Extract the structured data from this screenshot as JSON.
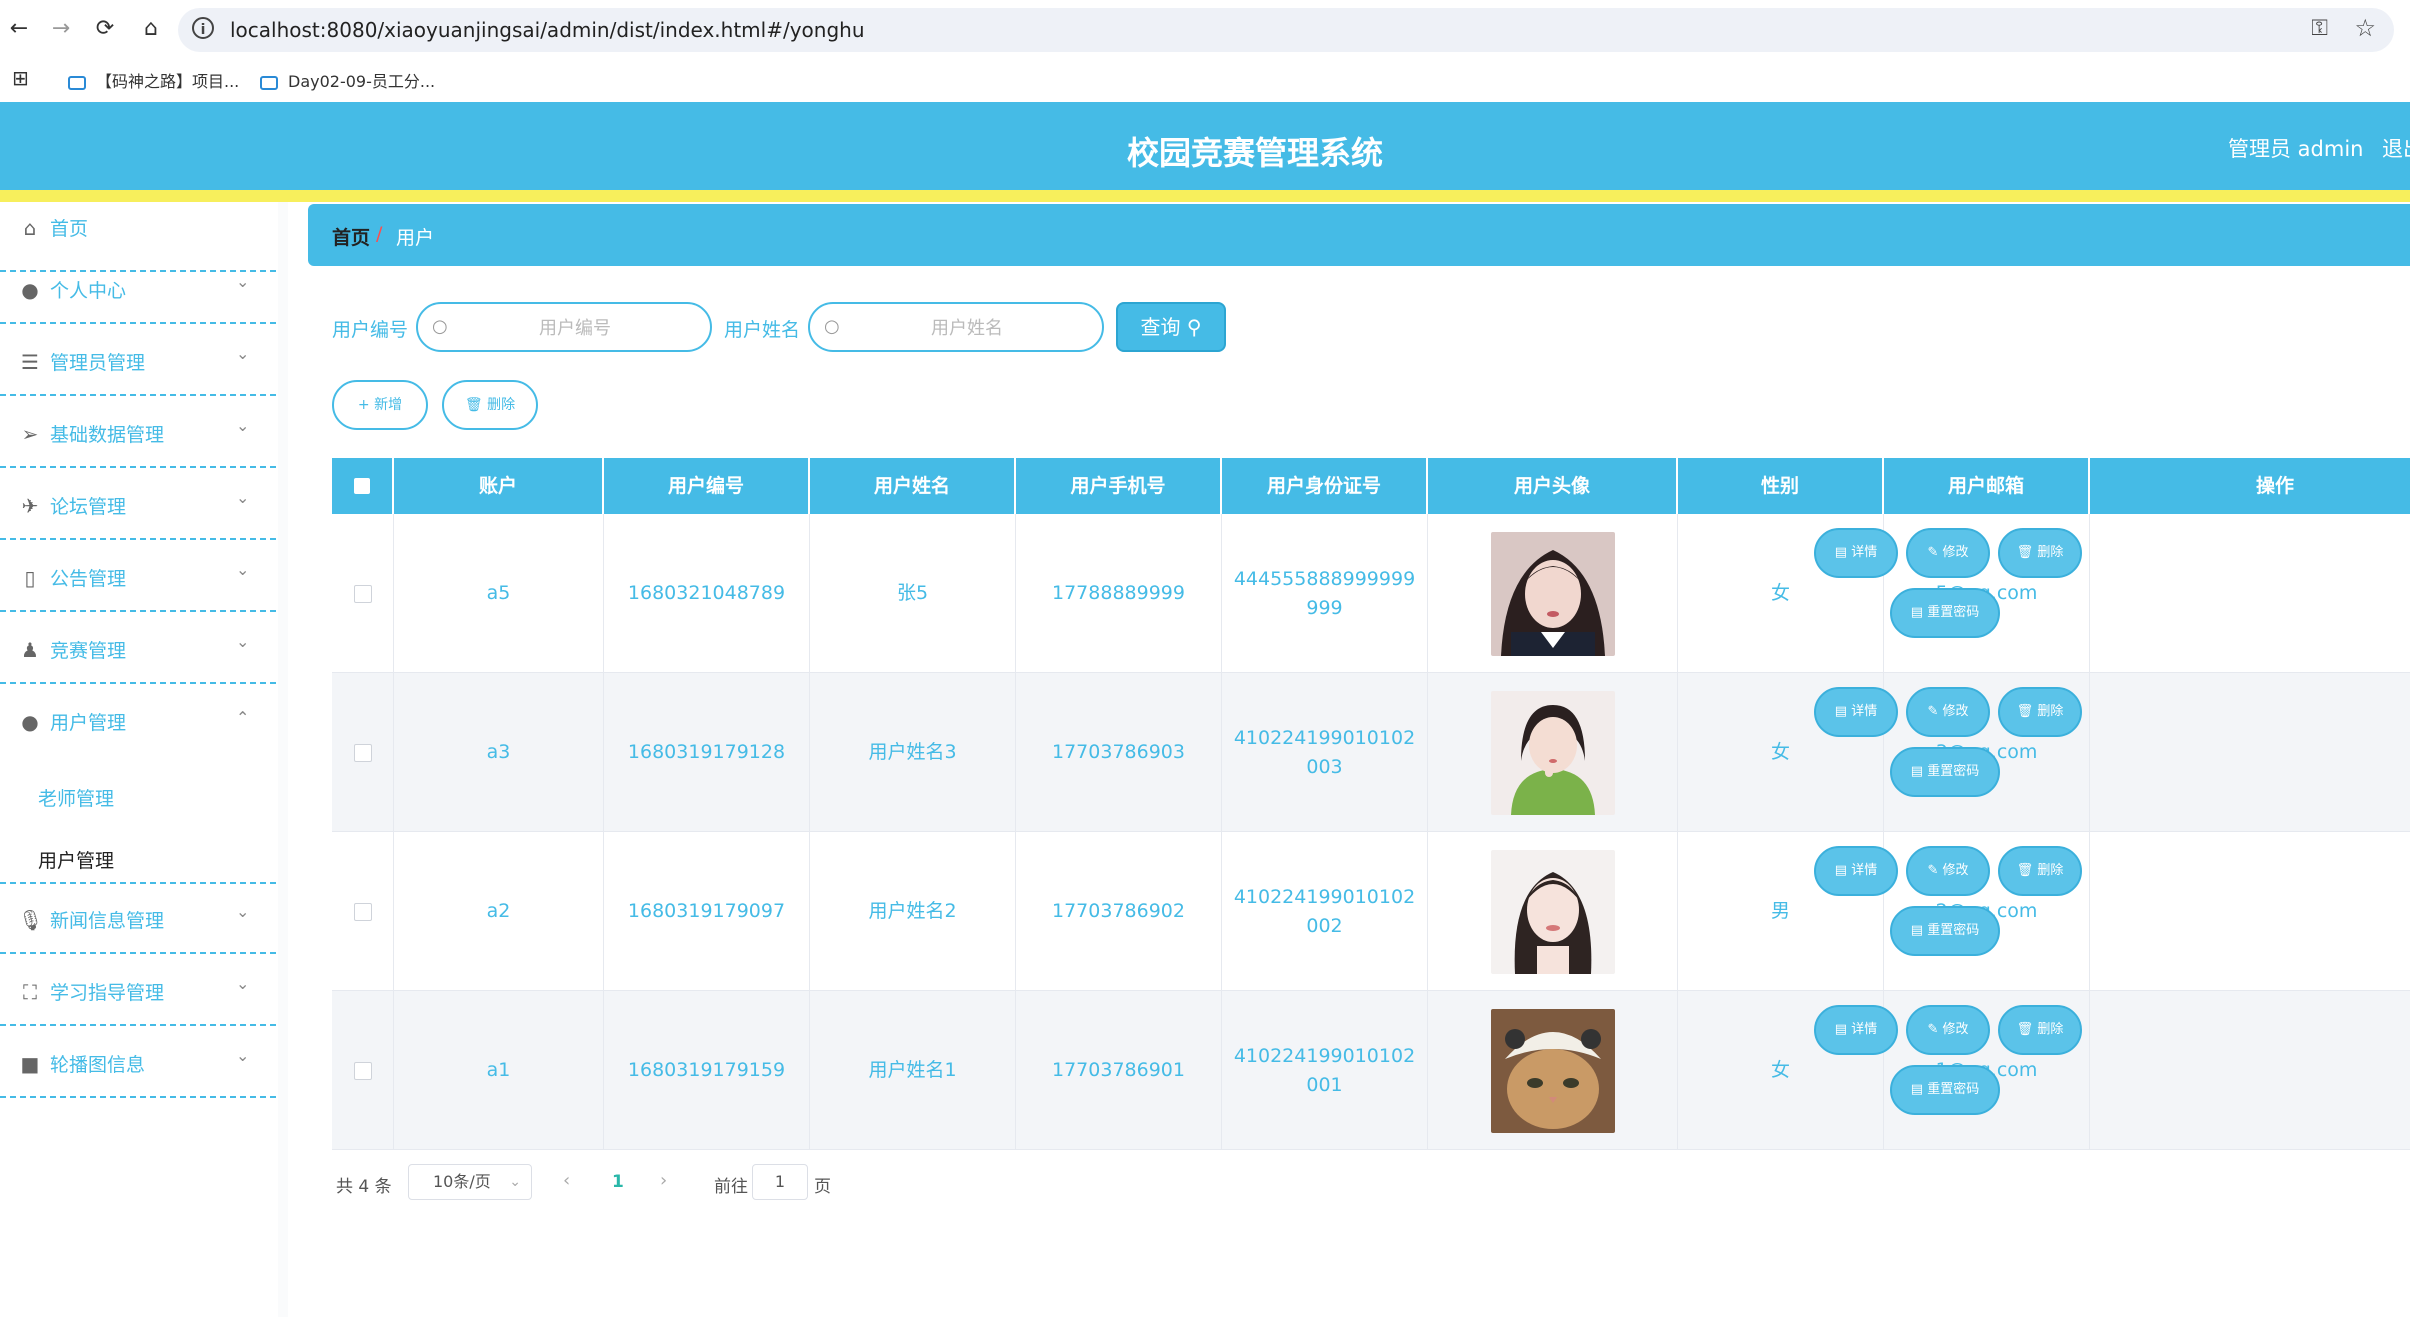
{
  "browser": {
    "url": "localhost:8080/xiaoyuanjingsai/admin/dist/index.html#/yonghu",
    "bookmarks": [
      {
        "label": "【码神之路】项目..."
      },
      {
        "label": "Day02-09-员工分..."
      }
    ]
  },
  "header": {
    "title": "校园竞赛管理系统",
    "user": "管理员 admin",
    "logout": "退出"
  },
  "sidebar": {
    "items": [
      {
        "label": "首页",
        "icon": "home-icon",
        "expandable": false
      },
      {
        "label": "个人中心",
        "icon": "person-icon",
        "expandable": true
      },
      {
        "label": "管理员管理",
        "icon": "list-icon",
        "expandable": true
      },
      {
        "label": "基础数据管理",
        "icon": "send-icon",
        "expandable": true
      },
      {
        "label": "论坛管理",
        "icon": "paper-plane-icon",
        "expandable": true
      },
      {
        "label": "公告管理",
        "icon": "phone-icon",
        "expandable": true
      },
      {
        "label": "竞赛管理",
        "icon": "stamp-icon",
        "expandable": true
      },
      {
        "label": "用户管理",
        "icon": "users-icon",
        "expandable": true,
        "open": true,
        "children": [
          {
            "label": "老师管理"
          },
          {
            "label": "用户管理",
            "active": true
          }
        ]
      },
      {
        "label": "新闻信息管理",
        "icon": "microphone-icon",
        "expandable": true
      },
      {
        "label": "学习指导管理",
        "icon": "fullscreen-icon",
        "expandable": true
      },
      {
        "label": "轮播图信息",
        "icon": "camera-icon",
        "expandable": true
      }
    ]
  },
  "breadcrumb": {
    "home": "首页",
    "separator": "/",
    "current": "用户"
  },
  "search": {
    "field1_label": "用户编号",
    "field1_placeholder": "用户编号",
    "field2_label": "用户姓名",
    "field2_placeholder": "用户姓名",
    "query_label": "查询"
  },
  "actions": {
    "add_label": "+ 新增",
    "delete_label": "删除"
  },
  "table": {
    "columns": [
      "账户",
      "用户编号",
      "用户姓名",
      "用户手机号",
      "用户身份证号",
      "用户头像",
      "性别",
      "用户邮箱",
      "操作"
    ],
    "rows": [
      {
        "account": "a5",
        "number": "1680321048789",
        "name": "张5",
        "phone": "17788889999",
        "id_card": "444555888999999999",
        "gender": "女",
        "email": "5@qq.com",
        "avatar": "girl-school-uniform"
      },
      {
        "account": "a3",
        "number": "1680319179128",
        "name": "用户姓名3",
        "phone": "17703786903",
        "id_card": "410224199010102003",
        "gender": "女",
        "email": "3@qq.com",
        "avatar": "girl-green-sweater"
      },
      {
        "account": "a2",
        "number": "1680319179097",
        "name": "用户姓名2",
        "phone": "17703786902",
        "id_card": "410224199010102002",
        "gender": "男",
        "email": "2@qq.com",
        "avatar": "woman-portrait"
      },
      {
        "account": "a1",
        "number": "1680319179159",
        "name": "用户姓名1",
        "phone": "17703786901",
        "id_card": "410224199010102001",
        "gender": "女",
        "email": "1@qq.com",
        "avatar": "cat-with-hat"
      }
    ],
    "op_labels": {
      "detail": "详情",
      "edit": "修改",
      "delete": "删除",
      "reset": "重置密码"
    }
  },
  "pagination": {
    "total": "共 4 条",
    "page_size": "10条/页",
    "current_page": "1",
    "goto_label": "前往",
    "goto_value": "1",
    "page_suffix": "页"
  },
  "colors": {
    "primary": "#45bbe6",
    "accent_bar": "#f7ef5c",
    "page_active": "#2ab7a9"
  }
}
